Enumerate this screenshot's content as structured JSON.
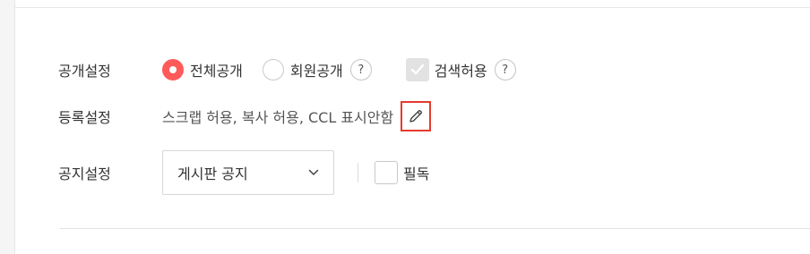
{
  "visibility": {
    "label": "공개설정",
    "options": [
      {
        "label": "전체공개",
        "selected": true
      },
      {
        "label": "회원공개",
        "selected": false
      }
    ],
    "help_glyph": "?",
    "search": {
      "label": "검색허용",
      "checked": true,
      "disabled": true
    },
    "accent_color": "#ff5a5a"
  },
  "registration": {
    "label": "등록설정",
    "value": "스크랩 허용, 복사 허용, CCL 표시안함",
    "edit_icon": "pencil-icon",
    "highlight_color": "#e53b2e"
  },
  "notice": {
    "label": "공지설정",
    "select_value": "게시판 공지",
    "select_icon": "chevron-down-icon",
    "pinned": {
      "label": "필독",
      "checked": false
    }
  }
}
